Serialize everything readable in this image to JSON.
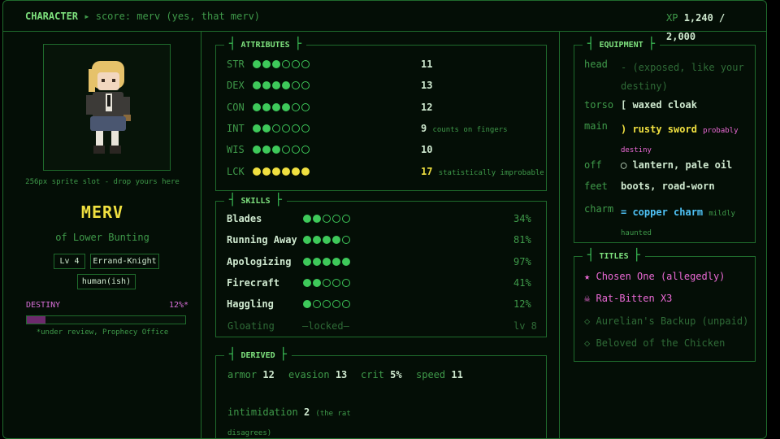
{
  "header": {
    "section": "CHARACTER",
    "arrow": "▸",
    "breadcrumb": "score: merv (yes, that merv)",
    "xp_label": "XP",
    "xp_value": "1,240 / 2,000"
  },
  "profile": {
    "sprite_note": "256px sprite slot - drop yours here",
    "name": "MERV",
    "subtitle": "of Lower Bunting",
    "tags": [
      "Lv 4",
      "Errand-Knight",
      "human(ish)"
    ],
    "destiny_label": "DESTINY",
    "destiny_value": "12%*",
    "destiny_fraction": 0.12,
    "destiny_note": "*under review, Prophecy Office"
  },
  "attributes": {
    "title": "ATTRIBUTES",
    "rows": [
      {
        "stat": "STR",
        "dots": 3,
        "value": "11",
        "note": ""
      },
      {
        "stat": "DEX",
        "dots": 4,
        "value": "13",
        "note": ""
      },
      {
        "stat": "CON",
        "dots": 4,
        "value": "12",
        "note": ""
      },
      {
        "stat": "INT",
        "dots": 2,
        "value": "9",
        "note": "counts on fingers"
      },
      {
        "stat": "WIS",
        "dots": 3,
        "value": "10",
        "note": ""
      },
      {
        "stat": "LCK",
        "dots": 6,
        "value": "17",
        "note": "statistically improbable"
      }
    ]
  },
  "skills": {
    "title": "SKILLS",
    "rows": [
      {
        "name": "Blades",
        "dots": 2,
        "pct": "34%"
      },
      {
        "name": "Running Away",
        "dots": 4,
        "pct": "81%"
      },
      {
        "name": "Apologizing",
        "dots": 5,
        "pct": "97%"
      },
      {
        "name": "Firecraft",
        "dots": 2,
        "pct": "41%"
      },
      {
        "name": "Haggling",
        "dots": 1,
        "pct": "12%"
      }
    ],
    "locked": {
      "name": "Gloating",
      "text": "—locked—",
      "level": "lv 8"
    }
  },
  "derived": {
    "title": "DERIVED",
    "armor_label": "armor",
    "armor": "12",
    "evasion_label": "evasion",
    "evasion": "13",
    "crit_label": "crit",
    "crit": "5%",
    "speed_label": "speed",
    "speed": "11",
    "intim_label": "intimidation",
    "intim": "2",
    "intim_note": "(the rat disagrees)"
  },
  "equipment": {
    "title": "EQUIPMENT",
    "head_label": "head",
    "head_value": "- (exposed, like your destiny)",
    "torso_label": "torso",
    "torso_value": "[ waxed cloak",
    "main_label": "main",
    "main_value": ") rusty sword",
    "main_note": "probably destiny",
    "off_label": "off",
    "off_value": "◯ lantern, pale oil",
    "feet_label": "feet",
    "feet_value": "boots, road-worn",
    "charm_label": "charm",
    "charm_value": "= copper charm",
    "charm_note": "mildly haunted"
  },
  "titles": {
    "title": "TITLES",
    "items": [
      {
        "icon": "★",
        "text": "Chosen One (allegedly)"
      },
      {
        "icon": "☠",
        "text": "Rat-Bitten X3"
      },
      {
        "icon": "◇",
        "text": "Aurelian's Backup (unpaid)"
      },
      {
        "icon": "◇",
        "text": "Beloved of the Chicken"
      }
    ]
  },
  "colors": {
    "accent": "#3ec95a",
    "gold": "#f0e040",
    "destiny": "#d86fd8",
    "charm": "#4fc3f7",
    "title_active": "#ec6ad6"
  }
}
